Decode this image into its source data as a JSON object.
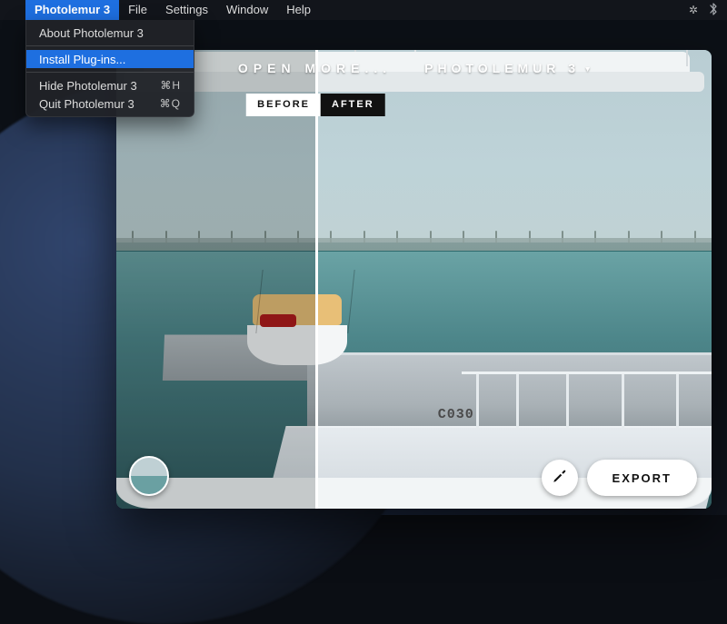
{
  "menubar": {
    "apple": "",
    "items": [
      "Photolemur 3",
      "File",
      "Settings",
      "Window",
      "Help"
    ],
    "active_index": 0,
    "right_icons": [
      "menu-extra-icon",
      "bluetooth-icon"
    ]
  },
  "dropdown": {
    "items": [
      {
        "label": "About Photolemur 3",
        "shortcut": ""
      },
      {
        "label": "Install Plug-ins...",
        "shortcut": "",
        "selected": true
      },
      {
        "label": "Hide Photolemur 3",
        "shortcut": "⌘H"
      },
      {
        "label": "Quit Photolemur 3",
        "shortcut": "⌘Q"
      }
    ],
    "separators_before": [
      2
    ]
  },
  "app": {
    "header": {
      "open_more": "OPEN MORE...",
      "title": "PHOTOLEMUR 3"
    },
    "compare": {
      "before": "BEFORE",
      "after": "AFTER",
      "slider_percent": 33.5
    },
    "dock_label": "C030",
    "export_label": "EXPORT"
  }
}
